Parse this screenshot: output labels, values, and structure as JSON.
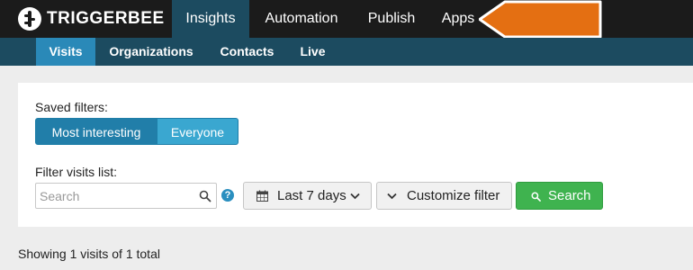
{
  "brand": {
    "name": "TRIGGERBEE",
    "logo_icon": "triggerbee-logo-icon"
  },
  "colors": {
    "topbar": "#1b1b1b",
    "subnav": "#1c4b60",
    "active_subnav": "#2a89b8",
    "accent_orange": "#e46f12",
    "search_green": "#3fb34f"
  },
  "top_nav": [
    {
      "label": "Insights",
      "active": true
    },
    {
      "label": "Automation",
      "active": false
    },
    {
      "label": "Publish",
      "active": false
    },
    {
      "label": "Apps",
      "active": false
    }
  ],
  "sub_nav": [
    {
      "label": "Visits",
      "active": true
    },
    {
      "label": "Organizations",
      "active": false
    },
    {
      "label": "Contacts",
      "active": false
    },
    {
      "label": "Live",
      "active": false
    }
  ],
  "saved_filters": {
    "label": "Saved filters:",
    "options": [
      {
        "label": "Most interesting",
        "selected": true
      },
      {
        "label": "Everyone",
        "selected": false
      }
    ]
  },
  "filter_visits": {
    "label": "Filter visits list:",
    "search": {
      "placeholder": "Search",
      "value": "",
      "icon": "search-icon"
    },
    "help_icon": "help-icon",
    "date_range": {
      "label": "Last 7 days",
      "icon": "calendar-icon",
      "chevron": "chevron-down-icon"
    },
    "customize": {
      "label": "Customize filter",
      "chevron": "chevron-down-icon"
    },
    "search_button": {
      "label": "Search",
      "icon": "search-icon"
    }
  },
  "status": {
    "text": "Showing 1 visits of 1 total"
  }
}
